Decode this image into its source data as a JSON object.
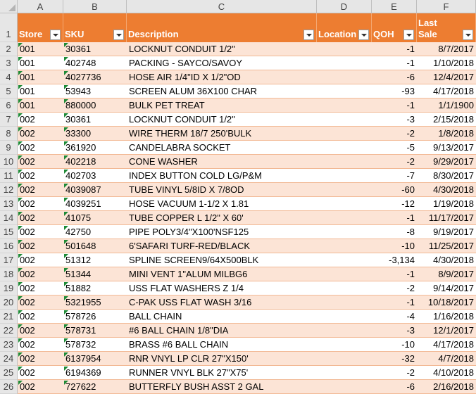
{
  "column_letters": [
    "A",
    "B",
    "C",
    "D",
    "E",
    "F"
  ],
  "header": {
    "store": "Store",
    "sku": "SKU",
    "description": "Description",
    "location": "Location",
    "qoh": "QOH",
    "last_sale_line1": "Last",
    "last_sale_line2": "Sale"
  },
  "colors": {
    "header_bg": "#ed7d31",
    "band": "#fce4d6",
    "flag": "#1e8a36"
  },
  "rows": [
    {
      "num": "2",
      "store": "001",
      "sku": "30361",
      "desc": "LOCKNUT CONDUIT 1/2\"",
      "loc": "",
      "qoh": "-1",
      "sale": "8/7/2017"
    },
    {
      "num": "3",
      "store": "001",
      "sku": "402748",
      "desc": "PACKING - SAYCO/SAVOY",
      "loc": "",
      "qoh": "-1",
      "sale": "1/10/2018"
    },
    {
      "num": "4",
      "store": "001",
      "sku": "4027736",
      "desc": "HOSE AIR 1/4\"ID X 1/2\"OD",
      "loc": "",
      "qoh": "-6",
      "sale": "12/4/2017"
    },
    {
      "num": "5",
      "store": "001",
      "sku": "53943",
      "desc": "SCREEN ALUM 36X100 CHAR",
      "loc": "",
      "qoh": "-93",
      "sale": "4/17/2018"
    },
    {
      "num": "6",
      "store": "001",
      "sku": "880000",
      "desc": "BULK PET TREAT",
      "loc": "",
      "qoh": "-1",
      "sale": "1/1/1900"
    },
    {
      "num": "7",
      "store": "002",
      "sku": "30361",
      "desc": "LOCKNUT CONDUIT 1/2\"",
      "loc": "",
      "qoh": "-3",
      "sale": "2/15/2018"
    },
    {
      "num": "8",
      "store": "002",
      "sku": "33300",
      "desc": "WIRE THERM 18/7 250'BULK",
      "loc": "",
      "qoh": "-2",
      "sale": "1/8/2018"
    },
    {
      "num": "9",
      "store": "002",
      "sku": "361920",
      "desc": "CANDELABRA SOCKET",
      "loc": "",
      "qoh": "-5",
      "sale": "9/13/2017"
    },
    {
      "num": "10",
      "store": "002",
      "sku": "402218",
      "desc": "CONE WASHER",
      "loc": "",
      "qoh": "-2",
      "sale": "9/29/2017"
    },
    {
      "num": "11",
      "store": "002",
      "sku": "402703",
      "desc": "INDEX BUTTON COLD LG/P&M",
      "loc": "",
      "qoh": "-7",
      "sale": "8/30/2017"
    },
    {
      "num": "12",
      "store": "002",
      "sku": "4039087",
      "desc": "TUBE VINYL 5/8ID X 7/8OD",
      "loc": "",
      "qoh": "-60",
      "sale": "4/30/2018"
    },
    {
      "num": "13",
      "store": "002",
      "sku": "4039251",
      "desc": "HOSE VACUUM 1-1/2 X 1.81",
      "loc": "",
      "qoh": "-12",
      "sale": "1/19/2018"
    },
    {
      "num": "14",
      "store": "002",
      "sku": "41075",
      "desc": "TUBE COPPER L 1/2\" X 60'",
      "loc": "",
      "qoh": "-1",
      "sale": "11/17/2017"
    },
    {
      "num": "15",
      "store": "002",
      "sku": "42750",
      "desc": "PIPE POLY3/4\"X100'NSF125",
      "loc": "",
      "qoh": "-8",
      "sale": "9/19/2017"
    },
    {
      "num": "16",
      "store": "002",
      "sku": "501648",
      "desc": "6'SAFARI TURF-RED/BLACK",
      "loc": "",
      "qoh": "-10",
      "sale": "11/25/2017"
    },
    {
      "num": "17",
      "store": "002",
      "sku": "51312",
      "desc": "SPLINE SCREEN9/64X500BLK",
      "loc": "",
      "qoh": "-3,134",
      "sale": "4/30/2018"
    },
    {
      "num": "18",
      "store": "002",
      "sku": "51344",
      "desc": "MINI VENT 1\"ALUM MILBG6",
      "loc": "",
      "qoh": "-1",
      "sale": "8/9/2017"
    },
    {
      "num": "19",
      "store": "002",
      "sku": "51882",
      "desc": "USS FLAT WASHERS Z 1/4",
      "loc": "",
      "qoh": "-2",
      "sale": "9/14/2017"
    },
    {
      "num": "20",
      "store": "002",
      "sku": "5321955",
      "desc": "C-PAK USS FLAT WASH 3/16",
      "loc": "",
      "qoh": "-1",
      "sale": "10/18/2017"
    },
    {
      "num": "21",
      "store": "002",
      "sku": "578726",
      "desc": "BALL CHAIN",
      "loc": "",
      "qoh": "-4",
      "sale": "1/16/2018"
    },
    {
      "num": "22",
      "store": "002",
      "sku": "578731",
      "desc": "#6 BALL CHAIN 1/8\"DIA",
      "loc": "",
      "qoh": "-3",
      "sale": "12/1/2017"
    },
    {
      "num": "23",
      "store": "002",
      "sku": "578732",
      "desc": "BRASS #6 BALL CHAIN",
      "loc": "",
      "qoh": "-10",
      "sale": "4/17/2018"
    },
    {
      "num": "24",
      "store": "002",
      "sku": "6137954",
      "desc": "RNR VNYL LP CLR 27\"X150'",
      "loc": "",
      "qoh": "-32",
      "sale": "4/7/2018"
    },
    {
      "num": "25",
      "store": "002",
      "sku": "6194369",
      "desc": "RUNNER VNYL BLK 27\"X75'",
      "loc": "",
      "qoh": "-2",
      "sale": "4/10/2018"
    },
    {
      "num": "26",
      "store": "002",
      "sku": "727622",
      "desc": "BUTTERFLY BUSH ASST 2 GAL",
      "loc": "",
      "qoh": "-6",
      "sale": "2/16/2018"
    }
  ]
}
